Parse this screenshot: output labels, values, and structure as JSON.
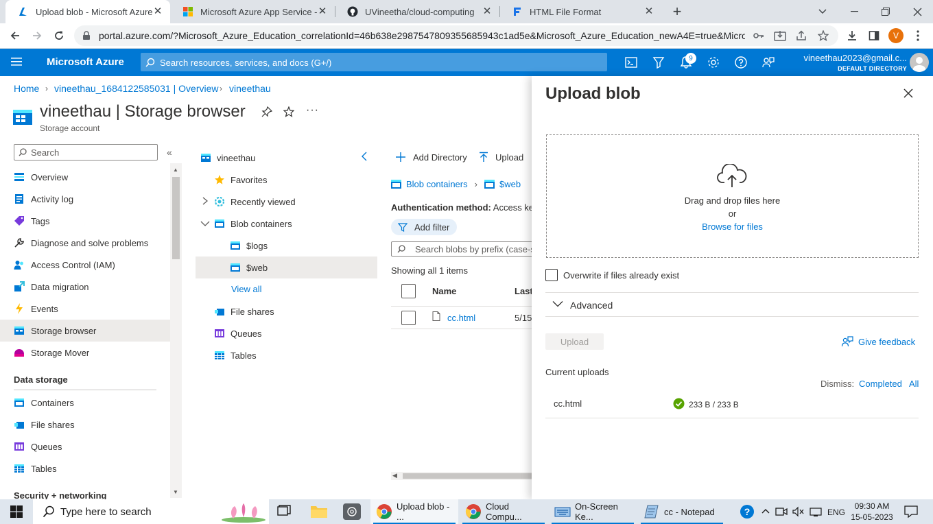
{
  "browser": {
    "tabs": [
      {
        "title": "Upload blob - Microsoft Azure",
        "active": true
      },
      {
        "title": "Microsoft Azure App Service - W",
        "active": false
      },
      {
        "title": "UVineetha/cloud-computing",
        "active": false
      },
      {
        "title": "HTML File Format",
        "active": false
      }
    ],
    "url": "portal.azure.com/?Microsoft_Azure_Education_correlationId=46b638e2987547809355685943c1ad5e&Microsoft_Azure_Education_newA4E=true&Micro...",
    "profile_initial": "V"
  },
  "header": {
    "brand": "Microsoft Azure",
    "search_placeholder": "Search resources, services, and docs (G+/)",
    "notification_count": "9",
    "account_email": "vineethau2023@gmail.c...",
    "account_directory": "DEFAULT DIRECTORY"
  },
  "breadcrumb": [
    "Home",
    "vineethau_1684122585031 | Overview",
    "vineethau"
  ],
  "page": {
    "title": "vineethau | Storage browser",
    "subtitle": "Storage account"
  },
  "nav": {
    "search_placeholder": "Search",
    "items": [
      {
        "label": "Overview",
        "icon": "overview-icon"
      },
      {
        "label": "Activity log",
        "icon": "activity-log-icon"
      },
      {
        "label": "Tags",
        "icon": "tag-icon"
      },
      {
        "label": "Diagnose and solve problems",
        "icon": "wrench-icon"
      },
      {
        "label": "Access Control (IAM)",
        "icon": "people-icon"
      },
      {
        "label": "Data migration",
        "icon": "data-migration-icon"
      },
      {
        "label": "Events",
        "icon": "lightning-icon"
      },
      {
        "label": "Storage browser",
        "icon": "storage-browser-icon",
        "selected": true
      },
      {
        "label": "Storage Mover",
        "icon": "storage-mover-icon"
      }
    ],
    "group_data_storage": "Data storage",
    "data_storage_items": [
      {
        "label": "Containers",
        "icon": "containers-icon"
      },
      {
        "label": "File shares",
        "icon": "file-shares-icon"
      },
      {
        "label": "Queues",
        "icon": "queues-icon"
      },
      {
        "label": "Tables",
        "icon": "tables-icon"
      }
    ],
    "group_security": "Security + networking"
  },
  "tree": {
    "root": "vineethau",
    "favorites": "Favorites",
    "recently_viewed": "Recently viewed",
    "blob_containers": "Blob containers",
    "logs": "$logs",
    "web": "$web",
    "view_all": "View all",
    "file_shares": "File shares",
    "queues": "Queues",
    "tables": "Tables"
  },
  "content": {
    "add_directory": "Add Directory",
    "upload": "Upload",
    "path": [
      "Blob containers",
      "$web"
    ],
    "auth_label": "Authentication method:",
    "auth_value": "Access key",
    "add_filter": "Add filter",
    "search_placeholder": "Search blobs by prefix (case-s",
    "showing": "Showing all 1 items",
    "columns": [
      "Name",
      "Last"
    ],
    "rows": [
      {
        "name": "cc.html",
        "modified": "5/15"
      }
    ]
  },
  "panel": {
    "title": "Upload blob",
    "drop_text": "Drag and drop files here",
    "or_text": "or",
    "browse": "Browse for files",
    "overwrite": "Overwrite if files already exist",
    "advanced": "Advanced",
    "upload_button": "Upload",
    "feedback": "Give feedback",
    "current_uploads": "Current uploads",
    "dismiss": "Dismiss:",
    "dismiss_completed": "Completed",
    "dismiss_all": "All",
    "uploads": [
      {
        "name": "cc.html",
        "progress": "233 B / 233 B",
        "status": "completed"
      }
    ]
  },
  "taskbar": {
    "search_placeholder": "Type here to search",
    "apps": [
      {
        "label": "Upload blob - ...",
        "active": true
      },
      {
        "label": "Cloud Compu..."
      },
      {
        "label": "On-Screen Ke..."
      },
      {
        "label": "cc - Notepad"
      }
    ],
    "language": "ENG",
    "time": "09:30 AM",
    "date": "15-05-2023"
  },
  "colors": {
    "azure_blue": "#0078d4",
    "success_green": "#57a300"
  }
}
